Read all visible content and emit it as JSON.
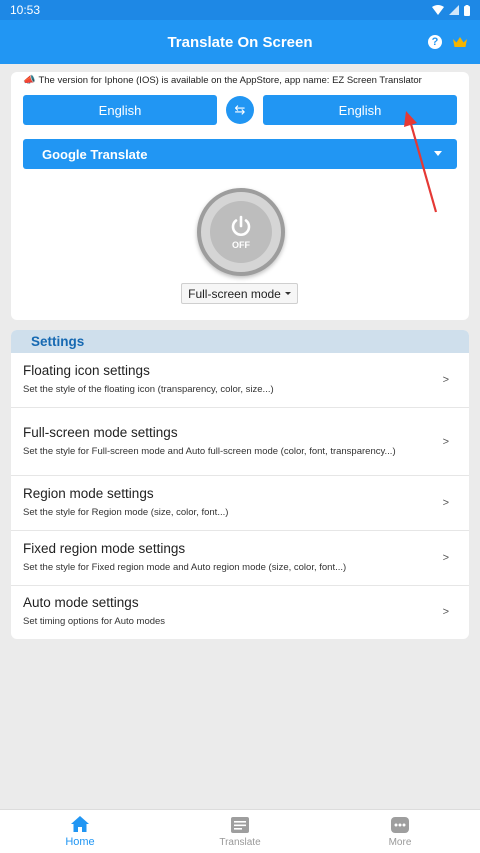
{
  "status": {
    "time": "10:53"
  },
  "app": {
    "title": "Translate On Screen"
  },
  "notice": {
    "text": "The version for Iphone (IOS) is available on the AppStore, app name: EZ Screen Translator"
  },
  "languages": {
    "source": "English",
    "target": "English"
  },
  "engine": {
    "selected": "Google Translate"
  },
  "power": {
    "state": "OFF"
  },
  "mode": {
    "selected": "Full-screen mode"
  },
  "settings": {
    "header": "Settings",
    "chevron": ">",
    "items": [
      {
        "title": "Floating icon settings",
        "desc": "Set the style of the floating icon (transparency, color, size...)"
      },
      {
        "title": "Full-screen mode settings",
        "desc": "Set the style for Full-screen mode and Auto full-screen mode (color, font, transparency...)"
      },
      {
        "title": "Region mode settings",
        "desc": "Set the style for Region mode (size, color, font...)"
      },
      {
        "title": "Fixed region mode settings",
        "desc": "Set the style for Fixed region mode and Auto region mode (size, color, font...)"
      },
      {
        "title": "Auto mode settings",
        "desc": "Set timing options for Auto modes"
      }
    ]
  },
  "nav": [
    {
      "label": "Home",
      "icon": "home-icon",
      "active": true
    },
    {
      "label": "Translate",
      "icon": "translate-icon",
      "active": false
    },
    {
      "label": "More",
      "icon": "more-icon",
      "active": false
    }
  ],
  "colors": {
    "primary": "#2196f3",
    "status_bar": "#1e88e5",
    "annotation": "#e53935",
    "settings_header_bg": "#cfdfec"
  }
}
